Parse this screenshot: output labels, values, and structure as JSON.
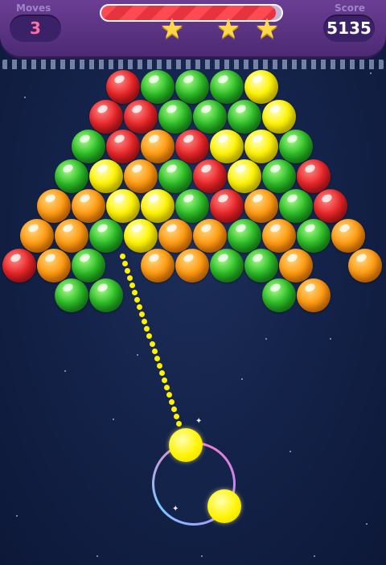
{
  "hud": {
    "moves_label": "Moves",
    "moves_value": "3",
    "score_label": "Score",
    "score_value": "5135",
    "progress_fraction": 0.97,
    "stars_earned": 3
  },
  "colors": {
    "red": "#e8262a",
    "green": "#2dbc27",
    "orange": "#ff9b12",
    "yellow": "#fff400",
    "header": "#5a3282",
    "background": "#14234a"
  },
  "board": {
    "rows": [
      [
        "",
        "",
        "",
        "red",
        "green",
        "green",
        "green",
        "yellow",
        "",
        "",
        ""
      ],
      [
        "",
        "",
        "red",
        "red",
        "green",
        "green",
        "green",
        "yellow",
        "",
        "",
        ""
      ],
      [
        "",
        "",
        "green",
        "red",
        "orange",
        "red",
        "yellow",
        "yellow",
        "green",
        "",
        ""
      ],
      [
        "",
        "green",
        "yellow",
        "orange",
        "green",
        "red",
        "yellow",
        "green",
        "red",
        "",
        ""
      ],
      [
        "",
        "orange",
        "orange",
        "yellow",
        "yellow",
        "green",
        "red",
        "orange",
        "green",
        "red",
        ""
      ],
      [
        "orange",
        "orange",
        "green",
        "yellow",
        "orange",
        "orange",
        "green",
        "orange",
        "green",
        "orange",
        ""
      ],
      [
        "red",
        "orange",
        "green",
        "",
        "orange",
        "orange",
        "green",
        "green",
        "orange",
        "",
        "orange"
      ],
      [
        "",
        "green",
        "green",
        "",
        "",
        "",
        "",
        "green",
        "orange",
        "",
        ""
      ]
    ]
  },
  "shooter": {
    "current_ball": "yellow",
    "next_ball": "yellow"
  }
}
